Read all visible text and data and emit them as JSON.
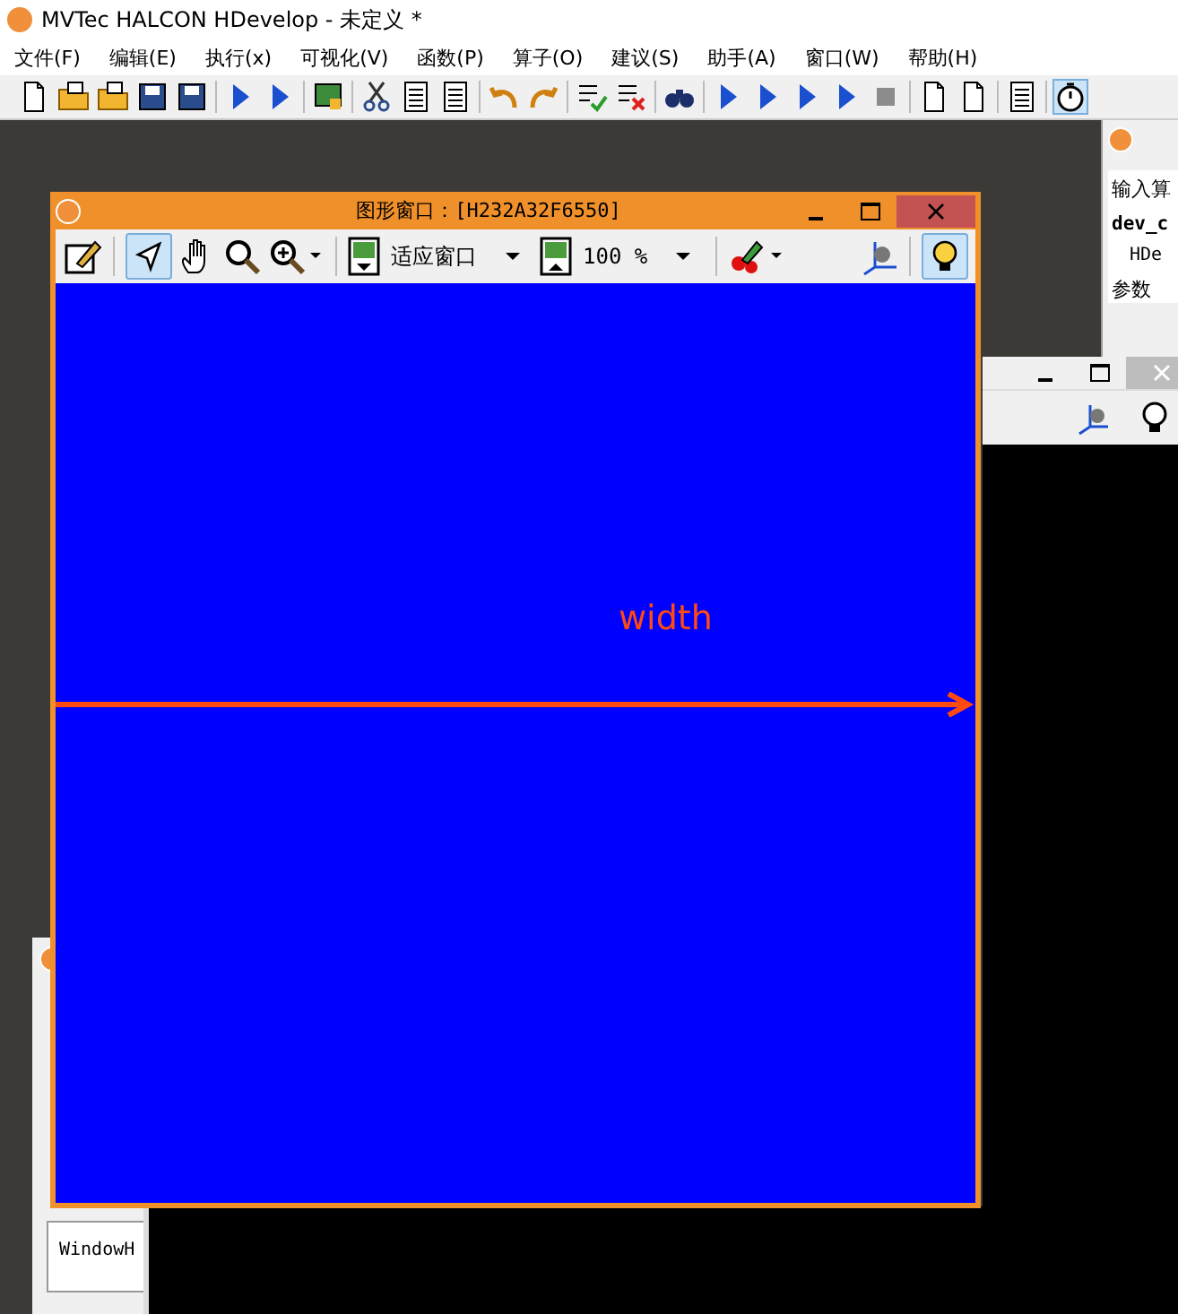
{
  "window": {
    "title": "MVTec HALCON HDevelop - 未定义 *"
  },
  "menu": [
    "文件(F)",
    "编辑(E)",
    "执行(x)",
    "可视化(V)",
    "函数(P)",
    "算子(O)",
    "建议(S)",
    "助手(A)",
    "窗口(W)",
    "帮助(H)"
  ],
  "graphics_window": {
    "title": "图形窗口：[H232A32F6550]",
    "zoom_mode": "适应窗口",
    "zoom_percent": "100 %",
    "canvas_label": "width"
  },
  "operator_panel": {
    "heading": "输入算",
    "operator": "dev_c",
    "line": "HDe",
    "section": "参数"
  },
  "variable_window": {
    "item": "WindowH"
  }
}
